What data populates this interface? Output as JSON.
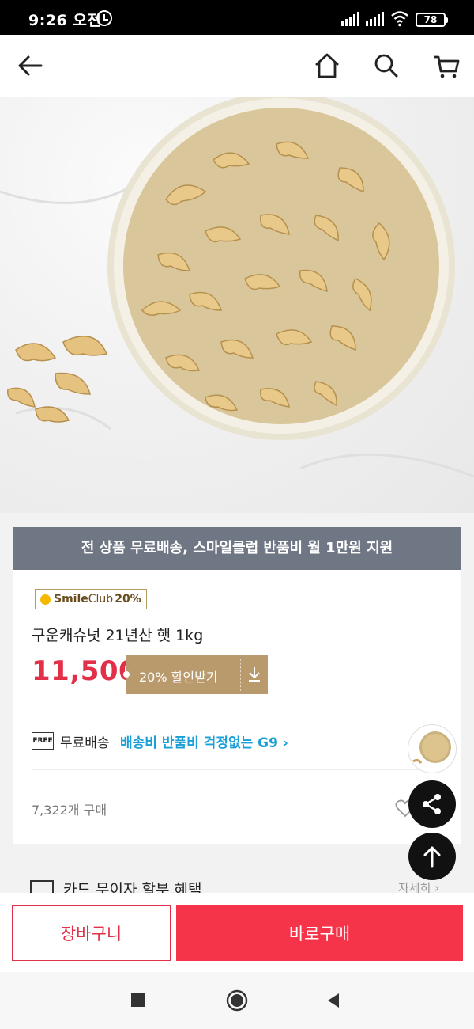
{
  "status_bar": {
    "time": "9:26 오전",
    "battery": "78",
    "icons": [
      "alarm-icon",
      "signal-icon",
      "signal-icon",
      "wifi-icon",
      "battery-icon"
    ]
  },
  "header": {
    "icons": [
      "back-arrow-icon",
      "home-icon",
      "search-icon",
      "cart-icon"
    ]
  },
  "product": {
    "image_desc_icon": "cashew-bowl-image",
    "promo_banner": "전 상품 무료배송, 스마일클럽 반품비 월 1만원 지원",
    "smile_badge": {
      "brand": "Smile",
      "club": "Club",
      "percent": "20%"
    },
    "title": "구운캐슈넛 21년산 햇 1kg",
    "price": "11,500",
    "coupon_label": "20% 할인받기",
    "shipping": {
      "free_icon_text": "FREE",
      "label": "무료배송",
      "promo": "배송비 반품비 걱정없는 G9 ›"
    },
    "purchase_count": "7,322개 구매"
  },
  "card_benefit": {
    "label": "카드 무이자 할부 혜택",
    "more": "자세히 ›"
  },
  "bottom_bar": {
    "cart_label": "장바구니",
    "buy_label": "바로구매"
  },
  "colors": {
    "accent": "#f5344a",
    "price": "#e23048",
    "banner": "#6f7785",
    "coupon": "#b89a6c",
    "link": "#1aa0d6"
  }
}
